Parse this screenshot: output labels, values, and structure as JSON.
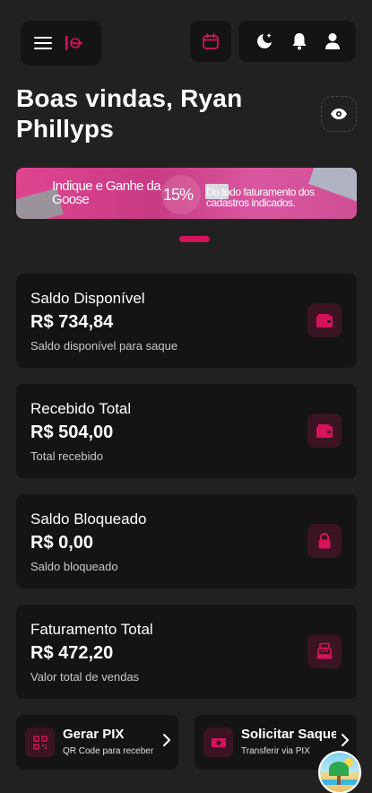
{
  "header": {
    "menu_icon": "hamburger-icon",
    "logo_icon": "brand-logo",
    "calendar_icon": "calendar-icon",
    "theme_icon": "moon-stars-icon",
    "notification_icon": "bell-icon",
    "profile_icon": "user-icon"
  },
  "welcome": {
    "text": "Boas vindas, Ryan Phillyps",
    "visibility_icon": "eye-icon"
  },
  "banner": {
    "title": "Indique e Ganhe da Goose",
    "subtitle": "",
    "percent": "15%",
    "percent_label": "",
    "description": "Do todo faturamento dos cadastros indicados."
  },
  "carousel": {
    "active_index": 0
  },
  "cards": [
    {
      "title": "Saldo Disponível",
      "value": "R$ 734,84",
      "subtitle": "Saldo disponível para saque",
      "icon": "wallet-icon"
    },
    {
      "title": "Recebido Total",
      "value": "R$ 504,00",
      "subtitle": "Total recebido",
      "icon": "wallet-icon"
    },
    {
      "title": "Saldo Bloqueado",
      "value": "R$ 0,00",
      "subtitle": "Saldo bloqueado",
      "icon": "lock-icon"
    },
    {
      "title": "Faturamento Total",
      "value": "R$ 472,20",
      "subtitle": "Valor total de vendas",
      "icon": "cash-register-icon"
    }
  ],
  "actions": [
    {
      "title": "Gerar PIX",
      "subtitle": "QR Code para receber",
      "icon": "qr-code-icon"
    },
    {
      "title": "Solicitar Saque",
      "subtitle": "Transferir via PIX",
      "icon": "money-icon"
    }
  ],
  "floating": {
    "icon": "beach-icon"
  },
  "colors": {
    "background": "#212121",
    "card": "#141414",
    "accent": "#d4145a",
    "icon_bg": "#3a1422"
  }
}
